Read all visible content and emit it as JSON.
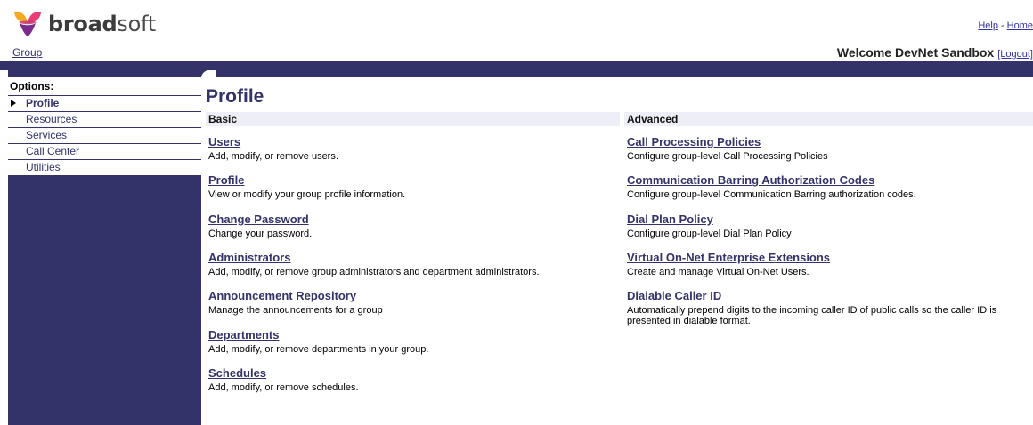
{
  "brand": {
    "name_bold": "broad",
    "name_light": "soft",
    "logo_colors": [
      "#f7a823",
      "#ea3c75",
      "#7b2b8c"
    ]
  },
  "header": {
    "help_label": "Help",
    "separator": "-",
    "home_label": "Home",
    "group_label": "Group",
    "welcome_text": "Welcome DevNet Sandbox",
    "logout_label": "[Logout]"
  },
  "sidebar": {
    "title": "Options:",
    "items": [
      {
        "label": "Profile",
        "current": true
      },
      {
        "label": "Resources"
      },
      {
        "label": "Services"
      },
      {
        "label": "Call Center"
      },
      {
        "label": "Utilities"
      }
    ]
  },
  "main": {
    "title": "Profile",
    "basic": {
      "header": "Basic",
      "items": [
        {
          "title": "Users",
          "desc": "Add, modify, or remove users."
        },
        {
          "title": "Profile",
          "desc": "View or modify your group profile information."
        },
        {
          "title": "Change Password",
          "desc": "Change your password."
        },
        {
          "title": "Administrators",
          "desc": "Add, modify, or remove group administrators and department administrators."
        },
        {
          "title": "Announcement Repository",
          "desc": "Manage the announcements for a group"
        },
        {
          "title": "Departments",
          "desc": "Add, modify, or remove departments in your group."
        },
        {
          "title": "Schedules",
          "desc": "Add, modify, or remove schedules."
        }
      ]
    },
    "advanced": {
      "header": "Advanced",
      "items": [
        {
          "title": "Call Processing Policies",
          "desc": "Configure group-level Call Processing Policies"
        },
        {
          "title": "Communication Barring Authorization Codes",
          "desc": "Configure group-level Communication Barring authorization codes."
        },
        {
          "title": "Dial Plan Policy",
          "desc": "Configure group-level Dial Plan Policy"
        },
        {
          "title": "Virtual On-Net Enterprise Extensions",
          "desc": "Create and manage Virtual On-Net Users."
        },
        {
          "title": "Dialable Caller ID",
          "desc": "Automatically prepend digits to the incoming caller ID of public calls so the caller ID is presented in dialable format."
        }
      ]
    }
  },
  "colors": {
    "navy": "#33336a",
    "header_bg": "#eeeef6",
    "link": "#3333aa"
  }
}
